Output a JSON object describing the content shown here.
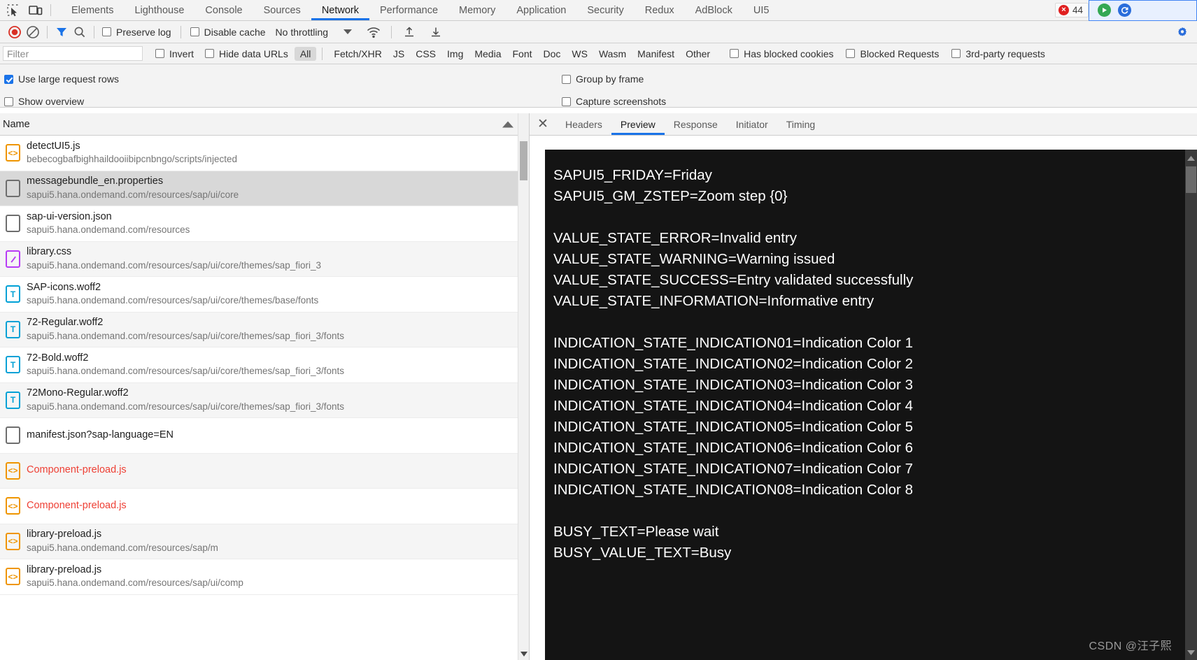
{
  "devtools_tabs": [
    {
      "label": "Elements",
      "active": false
    },
    {
      "label": "Lighthouse",
      "active": false
    },
    {
      "label": "Console",
      "active": false
    },
    {
      "label": "Sources",
      "active": false
    },
    {
      "label": "Network",
      "active": true
    },
    {
      "label": "Performance",
      "active": false
    },
    {
      "label": "Memory",
      "active": false
    },
    {
      "label": "Application",
      "active": false
    },
    {
      "label": "Security",
      "active": false
    },
    {
      "label": "Redux",
      "active": false
    },
    {
      "label": "AdBlock",
      "active": false
    },
    {
      "label": "UI5",
      "active": false
    }
  ],
  "status": {
    "error_count": "44",
    "inspect_icon": "inspect-element-icon",
    "device_icon": "device-toolbar-icon"
  },
  "network_toolbar": {
    "record_icon": "record-button-icon",
    "clear_icon": "clear-network-log-icon",
    "filter_icon": "filter-icon",
    "search_icon": "search-icon",
    "preserve_log": {
      "label": "Preserve log",
      "checked": false
    },
    "disable_cache": {
      "label": "Disable cache",
      "checked": false
    },
    "throttling": "No throttling",
    "wifi_icon": "network-conditions-icon",
    "import_icon": "import-har-icon",
    "export_icon": "export-har-icon",
    "settings_icon": "settings-gear-icon"
  },
  "filter_bar": {
    "placeholder": "Filter",
    "value": "",
    "invert": {
      "label": "Invert",
      "checked": false
    },
    "hide_data_urls": {
      "label": "Hide data URLs",
      "checked": false
    },
    "types": [
      {
        "label": "All",
        "selected": true
      },
      {
        "label": "Fetch/XHR",
        "selected": false
      },
      {
        "label": "JS",
        "selected": false
      },
      {
        "label": "CSS",
        "selected": false
      },
      {
        "label": "Img",
        "selected": false
      },
      {
        "label": "Media",
        "selected": false
      },
      {
        "label": "Font",
        "selected": false
      },
      {
        "label": "Doc",
        "selected": false
      },
      {
        "label": "WS",
        "selected": false
      },
      {
        "label": "Wasm",
        "selected": false
      },
      {
        "label": "Manifest",
        "selected": false
      },
      {
        "label": "Other",
        "selected": false
      }
    ],
    "has_blocked_cookies": {
      "label": "Has blocked cookies",
      "checked": false
    },
    "blocked_requests": {
      "label": "Blocked Requests",
      "checked": false
    },
    "third_party": {
      "label": "3rd-party requests",
      "checked": false
    }
  },
  "settings_pane": {
    "use_large_request_rows": {
      "label": "Use large request rows",
      "checked": true
    },
    "show_overview": {
      "label": "Show overview",
      "checked": false
    },
    "group_by_frame": {
      "label": "Group by frame",
      "checked": false
    },
    "capture_screenshots": {
      "label": "Capture screenshots",
      "checked": false
    }
  },
  "request_table": {
    "column_header": "Name",
    "rows": [
      {
        "name": "detectUI5.js",
        "url": "bebecogbafbighhaildooiibipcnbngo/scripts/injected",
        "icon": "js-file-icon",
        "kind": "js",
        "error": false,
        "selected": false
      },
      {
        "name": "messagebundle_en.properties",
        "url": "sapui5.hana.ondemand.com/resources/sap/ui/core",
        "icon": "generic-file-icon",
        "kind": "doc",
        "error": false,
        "selected": true
      },
      {
        "name": "sap-ui-version.json",
        "url": "sapui5.hana.ondemand.com/resources",
        "icon": "generic-file-icon",
        "kind": "doc",
        "error": false,
        "selected": false
      },
      {
        "name": "library.css",
        "url": "sapui5.hana.ondemand.com/resources/sap/ui/core/themes/sap_fiori_3",
        "icon": "stylesheet-icon",
        "kind": "css",
        "error": false,
        "selected": false
      },
      {
        "name": "SAP-icons.woff2",
        "url": "sapui5.hana.ondemand.com/resources/sap/ui/core/themes/base/fonts",
        "icon": "font-file-icon",
        "kind": "font",
        "error": false,
        "selected": false
      },
      {
        "name": "72-Regular.woff2",
        "url": "sapui5.hana.ondemand.com/resources/sap/ui/core/themes/sap_fiori_3/fonts",
        "icon": "font-file-icon",
        "kind": "font",
        "error": false,
        "selected": false
      },
      {
        "name": "72-Bold.woff2",
        "url": "sapui5.hana.ondemand.com/resources/sap/ui/core/themes/sap_fiori_3/fonts",
        "icon": "font-file-icon",
        "kind": "font",
        "error": false,
        "selected": false
      },
      {
        "name": "72Mono-Regular.woff2",
        "url": "sapui5.hana.ondemand.com/resources/sap/ui/core/themes/sap_fiori_3/fonts",
        "icon": "font-file-icon",
        "kind": "font",
        "error": false,
        "selected": false
      },
      {
        "name": "manifest.json?sap-language=EN",
        "url": "",
        "icon": "generic-file-icon",
        "kind": "doc",
        "error": false,
        "selected": false
      },
      {
        "name": "Component-preload.js",
        "url": "",
        "icon": "js-file-icon",
        "kind": "js",
        "error": true,
        "selected": false
      },
      {
        "name": "Component-preload.js",
        "url": "",
        "icon": "js-file-icon",
        "kind": "js",
        "error": true,
        "selected": false
      },
      {
        "name": "library-preload.js",
        "url": "sapui5.hana.ondemand.com/resources/sap/m",
        "icon": "js-file-icon",
        "kind": "js",
        "error": false,
        "selected": false
      },
      {
        "name": "library-preload.js",
        "url": "sapui5.hana.ondemand.com/resources/sap/ui/comp",
        "icon": "js-file-icon",
        "kind": "js",
        "error": false,
        "selected": false
      }
    ]
  },
  "detail_panel": {
    "close_icon": "close-icon",
    "tabs": [
      {
        "label": "Headers",
        "active": false
      },
      {
        "label": "Preview",
        "active": true
      },
      {
        "label": "Response",
        "active": false
      },
      {
        "label": "Initiator",
        "active": false
      },
      {
        "label": "Timing",
        "active": false
      }
    ],
    "preview_lines": [
      "SAPUI5_FRIDAY=Friday",
      "SAPUI5_GM_ZSTEP=Zoom step {0}",
      "",
      "VALUE_STATE_ERROR=Invalid entry",
      "VALUE_STATE_WARNING=Warning issued",
      "VALUE_STATE_SUCCESS=Entry validated successfully",
      "VALUE_STATE_INFORMATION=Informative entry",
      "",
      "INDICATION_STATE_INDICATION01=Indication Color 1",
      "INDICATION_STATE_INDICATION02=Indication Color 2",
      "INDICATION_STATE_INDICATION03=Indication Color 3",
      "INDICATION_STATE_INDICATION04=Indication Color 4",
      "INDICATION_STATE_INDICATION05=Indication Color 5",
      "INDICATION_STATE_INDICATION06=Indication Color 6",
      "INDICATION_STATE_INDICATION07=Indication Color 7",
      "INDICATION_STATE_INDICATION08=Indication Color 8",
      "",
      "BUSY_TEXT=Please wait",
      "BUSY_VALUE_TEXT=Busy"
    ]
  },
  "watermark": "CSDN @汪子熙",
  "colors": {
    "accent": "#1a73e8",
    "error": "#ee4035",
    "js_icon": "#ef9500",
    "css_icon": "#b83cf5",
    "font_icon": "#00a1d6",
    "preview_bg": "#141414"
  }
}
